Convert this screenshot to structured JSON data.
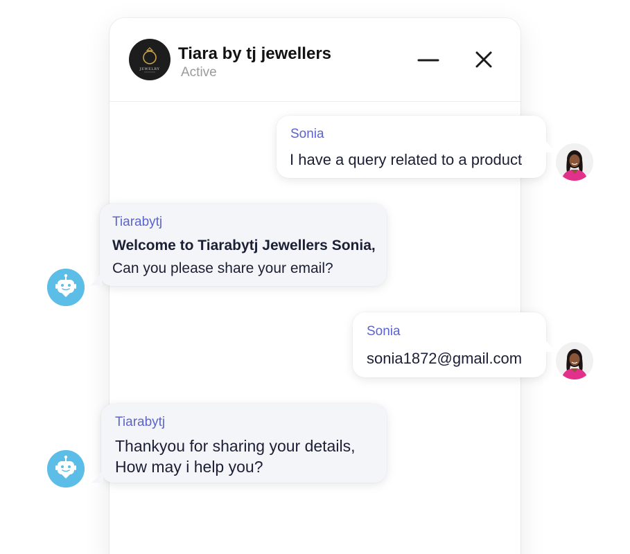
{
  "header": {
    "title": "Tiara by tj jewellers",
    "status": "Active",
    "logo_text": "JEWELRY"
  },
  "messages": [
    {
      "sender": "Sonia",
      "text": "I have a query related to a product"
    },
    {
      "sender": "Tiarabytj",
      "line1": "Welcome to Tiarabytj Jewellers Sonia,",
      "line2": "Can you please share your email?"
    },
    {
      "sender": "Sonia",
      "text": "sonia1872@gmail.com"
    },
    {
      "sender": "Tiarabytj",
      "line1": "Thankyou for sharing your details,",
      "line2": "How may i help you?"
    }
  ],
  "colors": {
    "sender_name": "#5a64cc",
    "bot_avatar": "#5cbde7",
    "user_bubble": "#ffffff",
    "bot_bubble": "#f4f5f8"
  },
  "icons": {
    "minimize": "minimize-icon",
    "close": "close-icon",
    "bot_avatar": "robot-icon",
    "user_avatar": "user-avatar"
  }
}
